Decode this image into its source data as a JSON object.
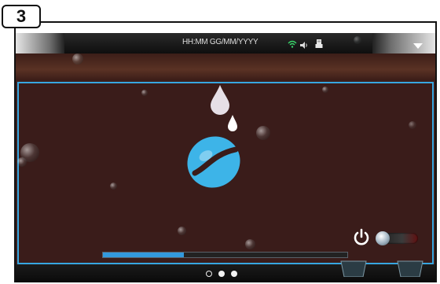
{
  "step": {
    "number": "3"
  },
  "statusbar": {
    "datetime": "HH:MM GG/MM/YYYY",
    "icons": [
      "wifi-icon",
      "volume-icon",
      "usb-icon",
      "menu-arrow-icon"
    ]
  },
  "logo": {
    "icons": [
      "water-drop-icon",
      "coffee-bean-icon"
    ]
  },
  "power": {
    "icon": "power-icon",
    "state": "off"
  },
  "progress": {
    "value": 0.33
  },
  "pager": {
    "count": 3,
    "active_index": 0
  },
  "colors": {
    "accent": "#37a6e0",
    "background": "#3a1c1a",
    "progress": "#3399dd"
  }
}
